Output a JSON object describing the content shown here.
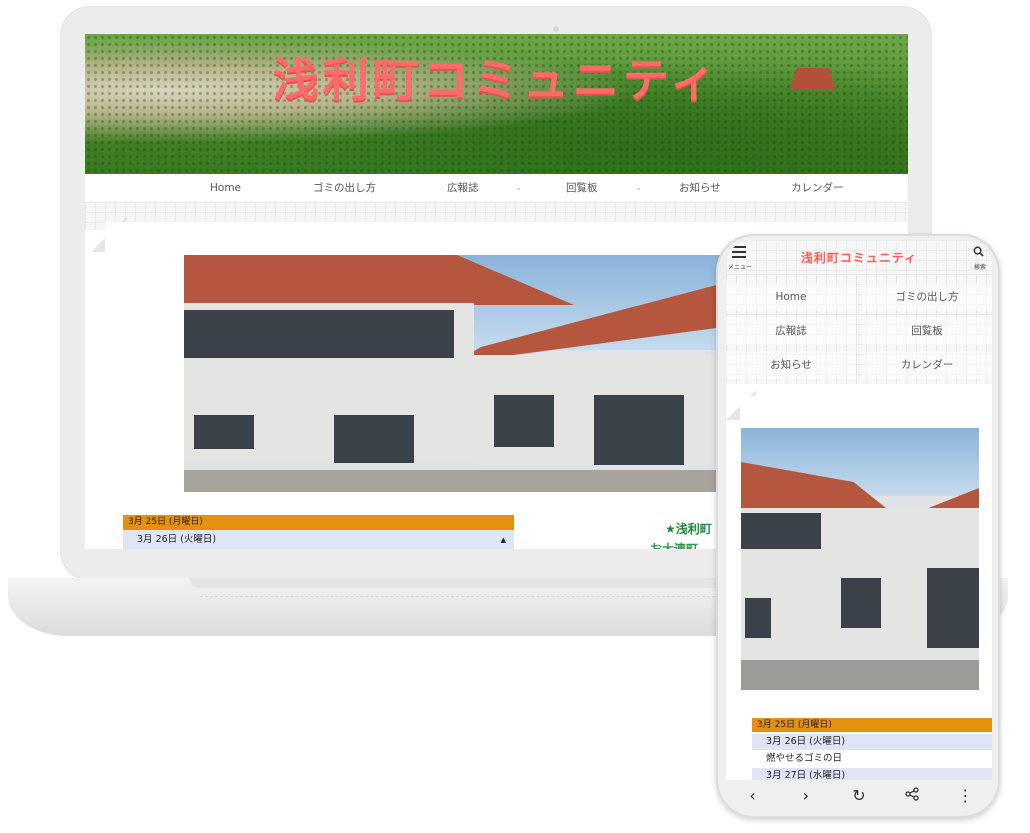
{
  "site": {
    "title": "浅利町コミュニティ"
  },
  "laptop": {
    "nav": [
      {
        "label": "Home"
      },
      {
        "label": "ゴミの出し方"
      },
      {
        "label": "広報誌",
        "dropdown": true
      },
      {
        "label": "回覧板",
        "dropdown": true
      },
      {
        "label": "お知らせ"
      },
      {
        "label": "カレンダー"
      }
    ],
    "calendar": {
      "header": "3月 25日 (月曜日)",
      "rows": [
        "3月 26日 (火曜日)"
      ]
    },
    "right_heading": "★浅利町",
    "right_sub": "お大連町..."
  },
  "phone": {
    "menu_label": "メニュー",
    "search_label": "検索",
    "nav": [
      "Home",
      "ゴミの出し方",
      "広報誌",
      "回覧板",
      "お知らせ",
      "カレンダー"
    ],
    "calendar": {
      "header": "3月 25日 (月曜日)",
      "rows": [
        "3月 26日 (火曜日)",
        "燃やせるゴミの日",
        "3月 27日 (水曜日)"
      ]
    },
    "toolbar": {
      "back": "‹",
      "forward": "›",
      "reload": "↻",
      "share": "share-icon",
      "more": "⋮"
    }
  },
  "colors": {
    "brand_title": "#ff6b6b",
    "calendar_header": "#e6900f",
    "calendar_row": "#dfe5f4",
    "heading_green": "#1f8a3a"
  }
}
